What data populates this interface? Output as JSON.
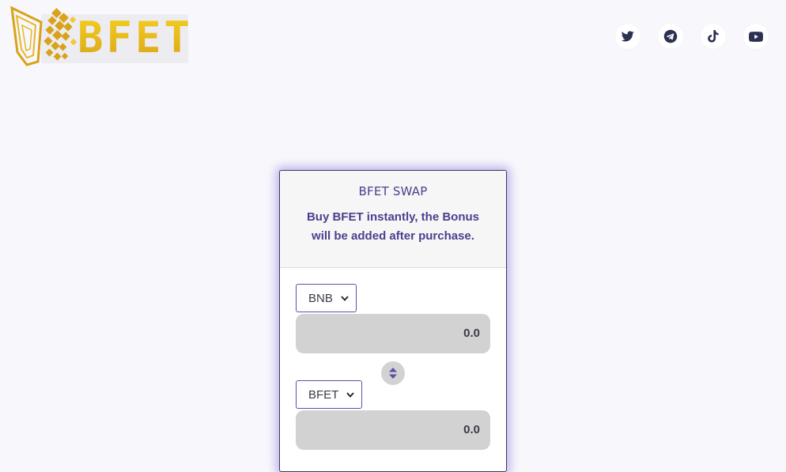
{
  "brand": {
    "logo_text": "BFET"
  },
  "socials": [
    {
      "name": "twitter-icon"
    },
    {
      "name": "telegram-icon"
    },
    {
      "name": "tiktok-icon"
    },
    {
      "name": "youtube-icon"
    }
  ],
  "swap": {
    "title": "BFET SWAP",
    "subtitle": "Buy BFET instantly, the Bonus will be added after purchase.",
    "from_token": "BNB",
    "from_amount": "0.0",
    "to_token": "BFET",
    "to_amount": "0.0"
  },
  "colors": {
    "accent": "#4b3f8e",
    "logo_gold": "#e0b21a",
    "card_glow": "#7c5ce0"
  }
}
